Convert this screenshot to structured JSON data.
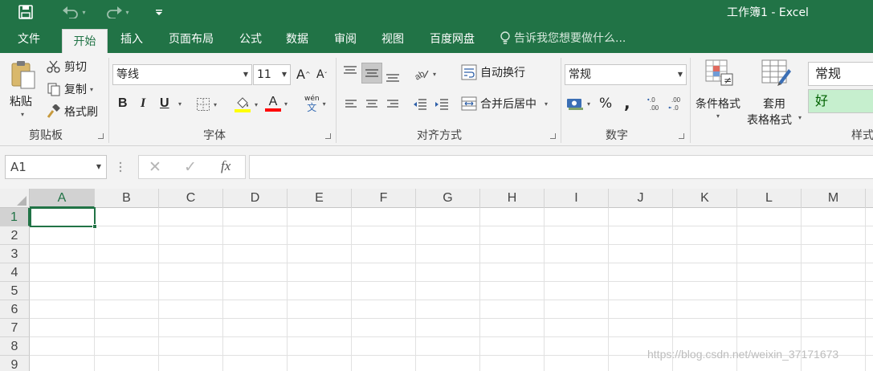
{
  "window": {
    "title": "工作簿1 - Excel"
  },
  "quick_access": {
    "save_icon": "save-icon",
    "undo_icon": "undo-icon",
    "redo_icon": "redo-icon",
    "customize_icon": "customize-qat-icon"
  },
  "tabs": [
    "文件",
    "开始",
    "插入",
    "页面布局",
    "公式",
    "数据",
    "审阅",
    "视图",
    "百度网盘"
  ],
  "active_tab": "开始",
  "tell_me": "告诉我您想要做什么...",
  "clipboard": {
    "paste": "粘贴",
    "cut": "剪切",
    "copy": "复制",
    "format_painter": "格式刷",
    "group": "剪贴板"
  },
  "font": {
    "name": "等线",
    "size": "11",
    "bold": "B",
    "italic": "I",
    "underline": "U",
    "highlight": "A",
    "font_color": "A",
    "phonetic": "wén",
    "group": "字体",
    "highlight_color": "#FFFF00",
    "font_color_value": "#FF0000"
  },
  "alignment": {
    "wrap": "自动换行",
    "merge": "合并后居中",
    "group": "对齐方式"
  },
  "number": {
    "format": "常规",
    "percent": "%",
    "comma": ",",
    "group": "数字"
  },
  "styles": {
    "conditional": "条件格式",
    "table_format_1": "套用",
    "table_format_2": "表格格式",
    "normal": "常规",
    "good": "好",
    "group": "样式",
    "good_fill": "#C6EFCE",
    "good_text": "#006100"
  },
  "formula_bar": {
    "name_box": "A1",
    "cancel": "✕",
    "enter": "✓",
    "fx": "fx",
    "content": ""
  },
  "columns": [
    "A",
    "B",
    "C",
    "D",
    "E",
    "F",
    "G",
    "H",
    "I",
    "J",
    "K",
    "L",
    "M"
  ],
  "rows": [
    "1",
    "2",
    "3",
    "4",
    "5",
    "6",
    "7",
    "8",
    "9"
  ],
  "selected_cell": "A1",
  "watermark": "https://blog.csdn.net/weixin_37171673",
  "colors": {
    "accent": "#217346",
    "ribbon": "#F3F3F3",
    "header": "#EFEFEF"
  }
}
